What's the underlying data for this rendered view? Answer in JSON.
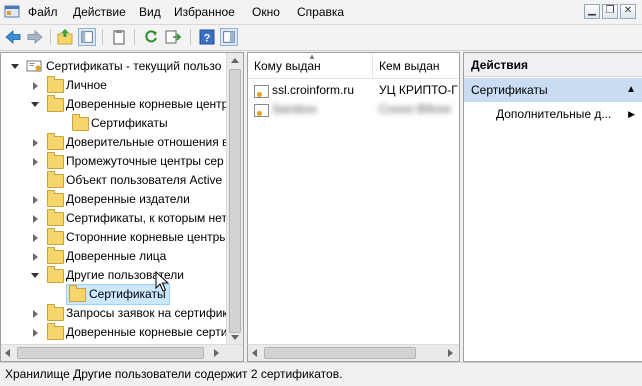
{
  "menu": {
    "items": [
      "Файл",
      "Действие",
      "Вид",
      "Избранное",
      "Окно",
      "Справка"
    ]
  },
  "tree": {
    "root_label": "Сертификаты - текущий пользо",
    "items": [
      {
        "label": "Личное",
        "level": 1,
        "expander": "closed"
      },
      {
        "label": "Доверенные корневые центр",
        "level": 1,
        "expander": "open"
      },
      {
        "label": "Сертификаты",
        "level": 2,
        "expander": "none"
      },
      {
        "label": "Доверительные отношения в",
        "level": 1,
        "expander": "closed"
      },
      {
        "label": "Промежуточные центры сер",
        "level": 1,
        "expander": "closed"
      },
      {
        "label": "Объект пользователя Active I",
        "level": 1,
        "expander": "none"
      },
      {
        "label": "Доверенные издатели",
        "level": 1,
        "expander": "closed"
      },
      {
        "label": "Сертификаты, к которым нет",
        "level": 1,
        "expander": "closed"
      },
      {
        "label": "Сторонние корневые центры",
        "level": 1,
        "expander": "closed"
      },
      {
        "label": "Доверенные лица",
        "level": 1,
        "expander": "closed"
      },
      {
        "label": "Другие пользователи",
        "level": 1,
        "expander": "open"
      },
      {
        "label": "Сертификаты",
        "level": 2,
        "expander": "none",
        "selected": true
      },
      {
        "label": "Запросы заявок на сертифик",
        "level": 1,
        "expander": "closed"
      },
      {
        "label": "Доверенные корневые серти",
        "level": 1,
        "expander": "closed"
      }
    ]
  },
  "list": {
    "columns": [
      "Кому выдан",
      "Кем выдан"
    ],
    "rows": [
      {
        "issued_to": "ssl.croinform.ru",
        "issued_by": "УЦ КРИПТО-Г",
        "blurred": false
      },
      {
        "issued_to": "Samboo",
        "issued_by": "Cosoo Bifone",
        "blurred": true
      }
    ]
  },
  "actions": {
    "header": "Действия",
    "selected_item": "Сертификаты",
    "items": [
      "Дополнительные д..."
    ]
  },
  "status": {
    "text": "Хранилище Другие пользователи содержит 2 сертификатов."
  }
}
